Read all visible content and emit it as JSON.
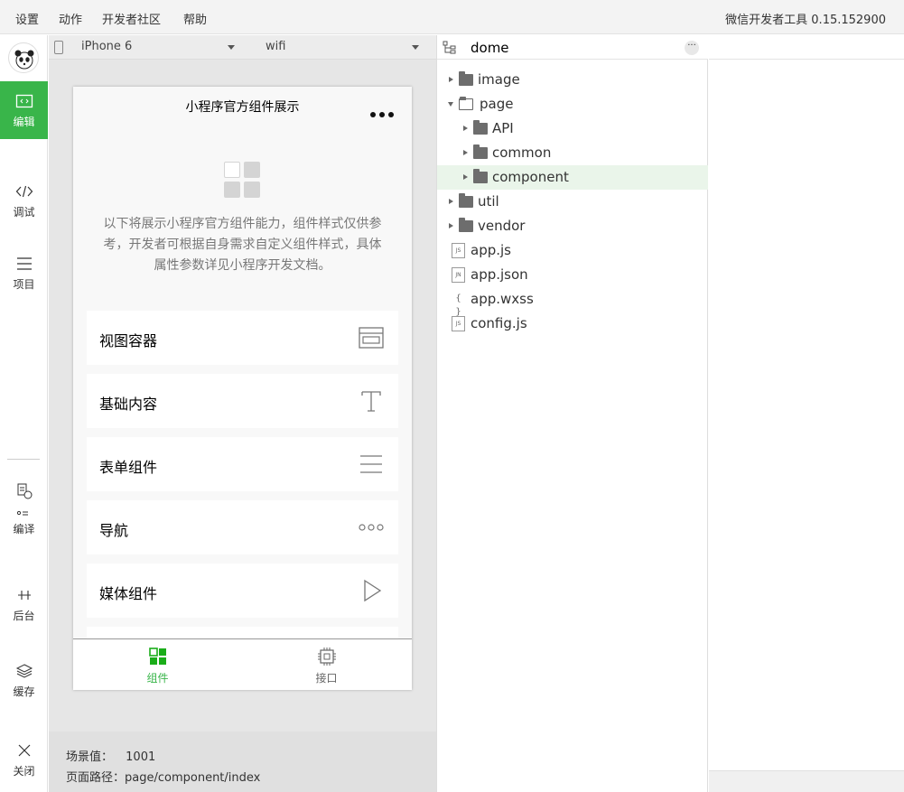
{
  "menubar": {
    "items": [
      "设置",
      "动作",
      "开发者社区",
      "帮助"
    ],
    "app_title": "微信开发者工具 0.15.152900"
  },
  "sidebar": {
    "items": [
      {
        "label": "编辑",
        "icon": "code-icon",
        "active": true
      },
      {
        "label": "调试",
        "icon": "debug-icon",
        "active": false
      },
      {
        "label": "项目",
        "icon": "menu-icon",
        "active": false
      },
      {
        "label": "编译",
        "icon": "compile-icon",
        "active": false
      },
      {
        "label": "后台",
        "icon": "background-icon",
        "active": false
      },
      {
        "label": "缓存",
        "icon": "layers-icon",
        "active": false
      },
      {
        "label": "关闭",
        "icon": "close-icon",
        "active": false
      }
    ]
  },
  "simulator": {
    "device": "iPhone 6",
    "network": "wifi",
    "page": {
      "title": "小程序官方组件展示",
      "intro": "以下将展示小程序官方组件能力，组件样式仅供参考，开发者可根据自身需求自定义组件样式，具体属性参数详见小程序开发文档。",
      "cards": [
        {
          "label": "视图容器",
          "icon": "view-container-icon"
        },
        {
          "label": "基础内容",
          "icon": "text-icon"
        },
        {
          "label": "表单组件",
          "icon": "form-lines-icon"
        },
        {
          "label": "导航",
          "icon": "dots-icon"
        },
        {
          "label": "媒体组件",
          "icon": "play-icon"
        }
      ],
      "tabs": [
        {
          "label": "组件",
          "icon": "grid-icon",
          "active": true
        },
        {
          "label": "接口",
          "icon": "chip-icon",
          "active": false
        }
      ]
    },
    "status": {
      "scene_label": "场景值：",
      "scene_value": "1001",
      "path_label": "页面路径：",
      "path_value": "page/component/index"
    }
  },
  "filetree": {
    "project": "dome",
    "more": "···",
    "nodes": [
      {
        "name": "image",
        "type": "folder",
        "expanded": false,
        "depth": 0
      },
      {
        "name": "page",
        "type": "folder",
        "expanded": true,
        "depth": 0
      },
      {
        "name": "API",
        "type": "folder",
        "expanded": false,
        "depth": 1
      },
      {
        "name": "common",
        "type": "folder",
        "expanded": false,
        "depth": 1
      },
      {
        "name": "component",
        "type": "folder",
        "expanded": false,
        "depth": 1,
        "selected": true
      },
      {
        "name": "util",
        "type": "folder",
        "expanded": false,
        "depth": 0
      },
      {
        "name": "vendor",
        "type": "folder",
        "expanded": false,
        "depth": 0
      },
      {
        "name": "app.js",
        "type": "file",
        "badge": "JS",
        "depth": 0
      },
      {
        "name": "app.json",
        "type": "file",
        "badge": "JN",
        "depth": 0
      },
      {
        "name": "app.wxss",
        "type": "file",
        "badge": "{ }",
        "depth": 0
      },
      {
        "name": "config.js",
        "type": "file",
        "badge": "JS",
        "depth": 0
      }
    ]
  },
  "colors": {
    "accent": "#39b54a",
    "selected_row": "#eaf5ea"
  }
}
